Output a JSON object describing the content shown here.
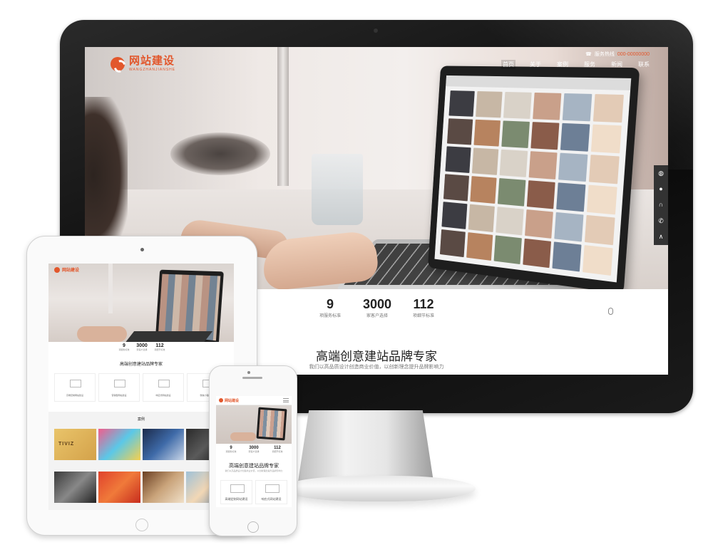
{
  "desktop": {
    "logo": {
      "name": "网站建设",
      "subtitle": "WANGZHANJIANSHE"
    },
    "hotline": {
      "label": "服务热线",
      "number": "000-00000000"
    },
    "nav": [
      "首页",
      "关于",
      "案例",
      "服务",
      "新闻",
      "联系"
    ],
    "sidebar_icons": [
      "wechat-icon",
      "qq-icon",
      "headset-icon",
      "phone-icon",
      "back-to-top-icon"
    ],
    "stats": [
      {
        "number": "9",
        "label": "项服务标准"
      },
      {
        "number": "3000",
        "label": "家客户选择"
      },
      {
        "number": "112",
        "label": "项细节标准"
      }
    ],
    "section_title": "高端创意建站品牌专家",
    "section_subtitle": "我们以高品质设计创造商业价值，以创新理念提升品牌影响力"
  },
  "tablet": {
    "logo": "网站建设",
    "stats": [
      {
        "number": "9",
        "label": "项服务标准"
      },
      {
        "number": "3000",
        "label": "家客户选择"
      },
      {
        "number": "112",
        "label": "项细节标准"
      }
    ],
    "section_title": "高端创意建站品牌专家",
    "cards": [
      "高端定制网站建设",
      "营销型网站建设",
      "响应式网站建设",
      "微信小程序开发"
    ],
    "case_title": "案例",
    "case_brand": "TIVIZ"
  },
  "phone": {
    "logo": "网站建设",
    "stats": [
      {
        "number": "9",
        "label": "项服务标准"
      },
      {
        "number": "3000",
        "label": "家客户选择"
      },
      {
        "number": "112",
        "label": "项细节标准"
      }
    ],
    "section_title": "高端创意建站品牌专家",
    "section_subtitle": "我们以高品质设计创造商业价值，以创新理念提升品牌影响力",
    "cards": [
      "高端定制网站建设",
      "响应式网站建设"
    ]
  },
  "colors": {
    "brand": "#e2572c",
    "sidebar": "#333333"
  }
}
